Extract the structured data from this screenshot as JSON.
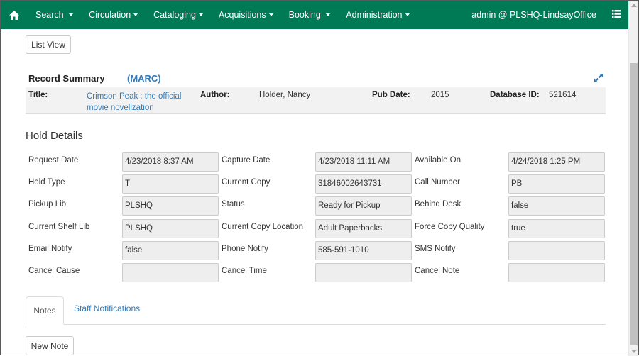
{
  "nav": {
    "items": [
      "Search",
      "Circulation",
      "Cataloging",
      "Acquisitions",
      "Booking",
      "Administration"
    ],
    "user": "admin @ PLSHQ-LindsayOffice",
    "brand_color": "#007a54"
  },
  "buttons": {
    "list_view": "List View",
    "new_note": "New Note"
  },
  "record_summary": {
    "heading": "Record Summary",
    "marc_link": "(MARC)",
    "title_label": "Title:",
    "title_value": "Crimson Peak : the official movie novelization",
    "author_label": "Author:",
    "author_value": "Holder, Nancy",
    "pub_date_label": "Pub Date:",
    "pub_date_value": "2015",
    "db_id_label": "Database ID:",
    "db_id_value": "521614"
  },
  "hold_details": {
    "heading": "Hold Details",
    "fields": [
      {
        "label": "Request Date",
        "value": "4/23/2018 8:37 AM"
      },
      {
        "label": "Capture Date",
        "value": "4/23/2018 11:11 AM"
      },
      {
        "label": "Available On",
        "value": "4/24/2018 1:25 PM"
      },
      {
        "label": "Hold Type",
        "value": "T"
      },
      {
        "label": "Current Copy",
        "value": "31846002643731"
      },
      {
        "label": "Call Number",
        "value": "PB"
      },
      {
        "label": "Pickup Lib",
        "value": "PLSHQ"
      },
      {
        "label": "Status",
        "value": "Ready for Pickup"
      },
      {
        "label": "Behind Desk",
        "value": "false"
      },
      {
        "label": "Current Shelf Lib",
        "value": "PLSHQ"
      },
      {
        "label": "Current Copy Location",
        "value": "Adult Paperbacks"
      },
      {
        "label": "Force Copy Quality",
        "value": "true"
      },
      {
        "label": "Email Notify",
        "value": "false"
      },
      {
        "label": "Phone Notify",
        "value": "585-591-1010"
      },
      {
        "label": "SMS Notify",
        "value": ""
      },
      {
        "label": "Cancel Cause",
        "value": ""
      },
      {
        "label": "Cancel Time",
        "value": ""
      },
      {
        "label": "Cancel Note",
        "value": ""
      }
    ]
  },
  "tabs": [
    "Notes",
    "Staff Notifications"
  ],
  "icons": {
    "home": "home-icon",
    "menu": "hamburger-menu-icon",
    "expand": "expand-icon"
  }
}
